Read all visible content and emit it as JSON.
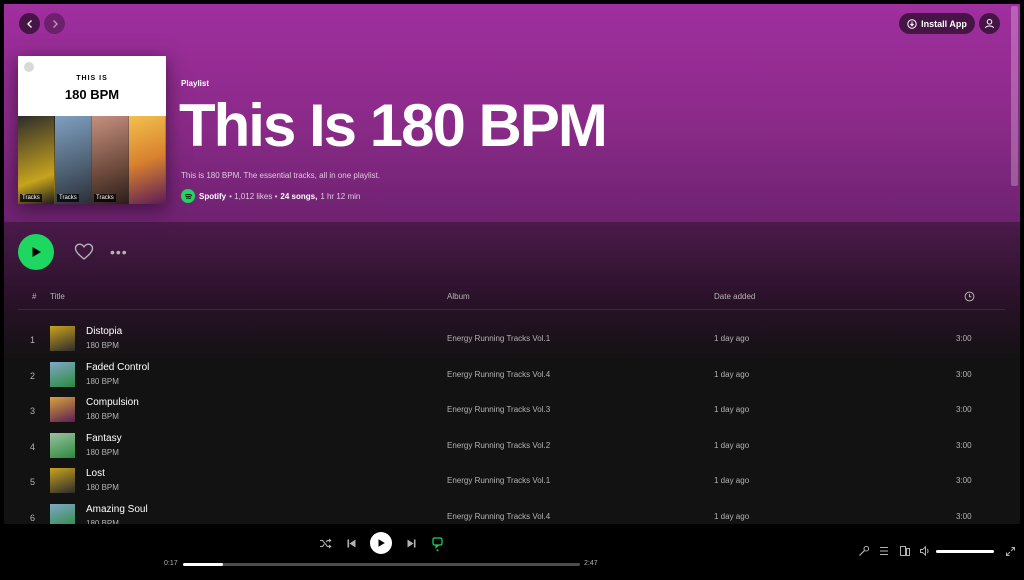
{
  "header": {
    "install_label": "Install App"
  },
  "playlist": {
    "type_label": "Playlist",
    "title": "This Is 180 BPM",
    "description": "This is 180 BPM. The essential tracks, all in one playlist.",
    "owner": "Spotify",
    "likes": "• 1,012 likes •",
    "songs": "24 songs,",
    "duration": "1 hr 12 min",
    "cover": {
      "line1": "THIS IS",
      "line2": "180 BPM",
      "tag": "Tracks"
    }
  },
  "actions": {
    "more_label": "•••"
  },
  "table": {
    "headers": {
      "num": "#",
      "title": "Title",
      "album": "Album",
      "date": "Date added"
    },
    "rows": [
      {
        "num": "1",
        "title": "Distopia",
        "artist": "180 BPM",
        "album": "Energy Running Tracks Vol.1",
        "date": "1 day ago",
        "duration": "3:00",
        "art": "a1"
      },
      {
        "num": "2",
        "title": "Faded Control",
        "artist": "180 BPM",
        "album": "Energy Running Tracks Vol.4",
        "date": "1 day ago",
        "duration": "3:00",
        "art": "a2"
      },
      {
        "num": "3",
        "title": "Compulsion",
        "artist": "180 BPM",
        "album": "Energy Running Tracks Vol.3",
        "date": "1 day ago",
        "duration": "3:00",
        "art": "a3"
      },
      {
        "num": "4",
        "title": "Fantasy",
        "artist": "180 BPM",
        "album": "Energy Running Tracks Vol.2",
        "date": "1 day ago",
        "duration": "3:00",
        "art": "a4"
      },
      {
        "num": "5",
        "title": "Lost",
        "artist": "180 BPM",
        "album": "Energy Running Tracks Vol.1",
        "date": "1 day ago",
        "duration": "3:00",
        "art": "a1"
      },
      {
        "num": "6",
        "title": "Amazing Soul",
        "artist": "180 BPM",
        "album": "Energy Running Tracks Vol.4",
        "date": "1 day ago",
        "duration": "3:00",
        "art": "a2"
      }
    ]
  },
  "player": {
    "elapsed": "0:17",
    "total": "2:47",
    "progress_fraction": 0.1,
    "volume_fraction": 1.0
  },
  "colors": {
    "accent": "#1ed760",
    "hero": "#a02f9f",
    "background": "#121212"
  }
}
